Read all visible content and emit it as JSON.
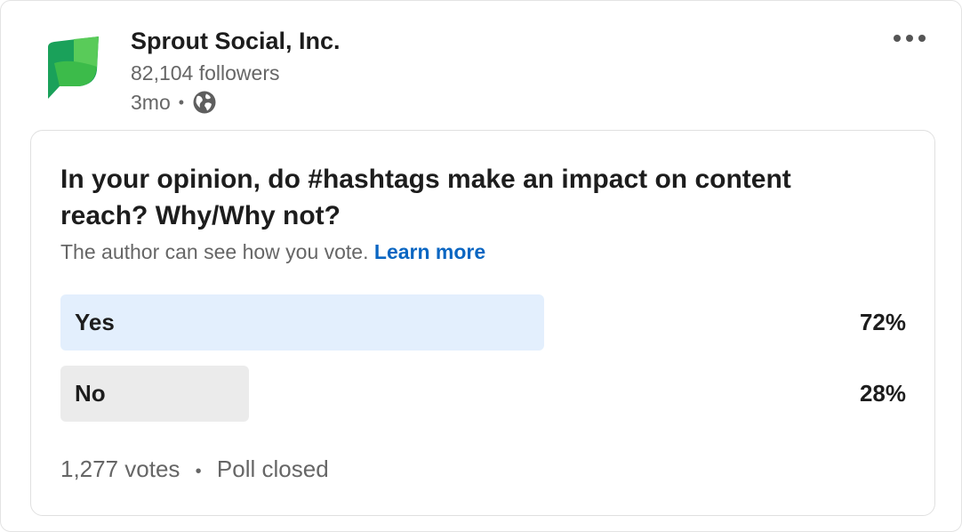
{
  "post": {
    "company_name": "Sprout Social, Inc.",
    "followers": "82,104 followers",
    "time": "3mo",
    "separator": "•",
    "visibility_icon": "globe-icon",
    "logo_icon": "sprout-social-leaf-logo",
    "more_icon": "more-horizontal-icon"
  },
  "poll": {
    "question": "In your opinion, do #hashtags make an impact on content reach? Why/Why not?",
    "notice": "The author can see how you vote.",
    "learn_more": "Learn more",
    "options": [
      {
        "label": "Yes",
        "percent_text": "72%",
        "percent": 72,
        "color": "#e3effd",
        "leading": true
      },
      {
        "label": "No",
        "percent_text": "28%",
        "percent": 28,
        "color": "#ebebeb",
        "leading": false
      }
    ],
    "votes": "1,277 votes",
    "separator": "•",
    "status": "Poll closed"
  },
  "colors": {
    "link": "#0a66c2",
    "leading_bar": "#e3effd",
    "other_bar": "#ebebeb",
    "brand_green": "#59cb59"
  }
}
